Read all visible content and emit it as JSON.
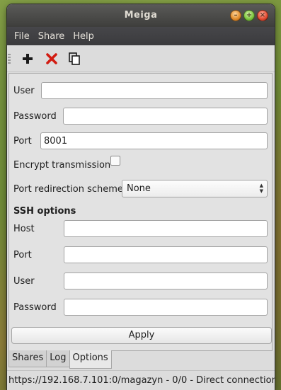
{
  "window": {
    "title": "Meiga"
  },
  "menu": [
    "File",
    "Share",
    "Help"
  ],
  "toolbar": {
    "add_icon": "plus-icon",
    "remove_icon": "red-x-icon",
    "copy_icon": "copy-icon"
  },
  "form": {
    "user_label": "User",
    "user_value": "",
    "password_label": "Password",
    "password_value": "",
    "port_label": "Port",
    "port_value": "8001",
    "encrypt_label": "Encrypt transmission",
    "encrypt_checked": false,
    "redirection_label": "Port redirection scheme",
    "redirection_value": "None"
  },
  "ssh": {
    "section_title": "SSH options",
    "host_label": "Host",
    "host_value": "",
    "port_label": "Port",
    "port_value": "",
    "user_label": "User",
    "user_value": "",
    "password_label": "Password",
    "password_value": ""
  },
  "apply_label": "Apply",
  "tabs": [
    "Shares",
    "Log",
    "Options"
  ],
  "active_tab": "Options",
  "status": "https://192.168.7.101:0/magazyn - 0/0 - Direct connection",
  "colors": {
    "titlebar": "#3e3e3c",
    "remove_icon": "#d21c12"
  }
}
